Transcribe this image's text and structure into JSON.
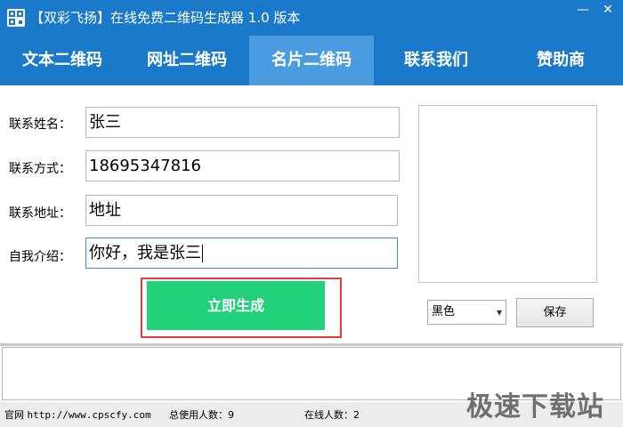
{
  "window": {
    "title": "【双彩飞扬】在线免费二维码生成器 1.0 版本",
    "minimize_glyph": "—",
    "close_glyph": "✕"
  },
  "tabs": [
    {
      "label": "文本二维码",
      "active": false
    },
    {
      "label": "网址二维码",
      "active": false
    },
    {
      "label": "名片二维码",
      "active": true
    },
    {
      "label": "联系我们",
      "active": false
    },
    {
      "label": "赞助商",
      "active": false
    }
  ],
  "form": {
    "name_label": "联系姓名：",
    "name_value": "张三",
    "phone_label": "联系方式：",
    "phone_value": "18695347816",
    "address_label": "联系地址：",
    "address_value": "地址",
    "intro_label": "自我介绍：",
    "intro_value": "你好，我是张三"
  },
  "actions": {
    "generate_label": "立即生成",
    "color_selected": "黑色",
    "save_label": "保存"
  },
  "status": {
    "site_label": "官网",
    "site_url": "http://www.cpscfy.com",
    "total_users": "总使用人数：9",
    "online_users": "在线人数：2"
  },
  "watermark": "极速下载站",
  "colors": {
    "primary": "#1a79c8",
    "active_tab": "#4a9be0",
    "generate_button": "#22d17a",
    "highlight_border": "#e23d3d"
  }
}
